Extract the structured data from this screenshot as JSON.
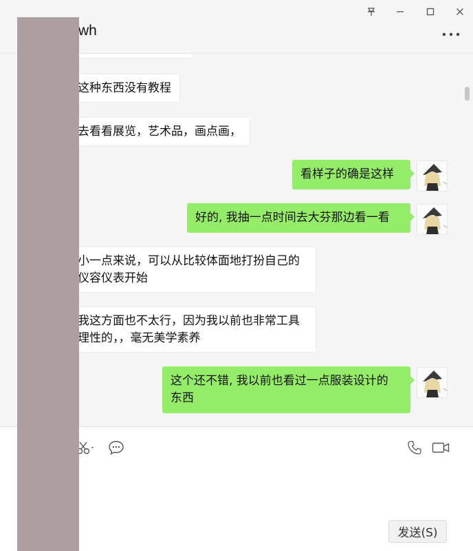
{
  "window": {
    "title": "wh",
    "controls": {
      "pin_icon": "pin-icon",
      "minimize_icon": "minimize-icon",
      "maximize_icon": "maximize-icon",
      "close_icon": "close-icon"
    },
    "more_icon": "more-dots-icon"
  },
  "messages": [
    {
      "side": "in",
      "text": "这种东西没有教程"
    },
    {
      "side": "in",
      "text": "去看看展览，艺术品，画点画，"
    },
    {
      "side": "out",
      "text": "看样子的确是这样"
    },
    {
      "side": "out",
      "text": "好的, 我抽一点时间去大芬那边看一看"
    },
    {
      "side": "in",
      "line1": "小一点来说，可以从比较体面地打扮自己的",
      "line2": "仪容仪表开始"
    },
    {
      "side": "in",
      "line1": "我这方面也不太行，因为我以前也非常工具",
      "line2": "理性的，，毫无美学素养"
    },
    {
      "side": "out",
      "line1": "这个还不错, 我以前也看过一点服装设计的",
      "line2": "东西"
    }
  ],
  "toolbar": {
    "icons": [
      "scissors-icon",
      "chat-bubble-icon",
      "phone-icon",
      "video-icon"
    ]
  },
  "send_label": "发送(S)",
  "colors": {
    "outgoing_bubble": "#95ec69",
    "incoming_bubble": "#ffffff",
    "background": "#f5f5f5",
    "redaction": "#ad9e9f"
  }
}
